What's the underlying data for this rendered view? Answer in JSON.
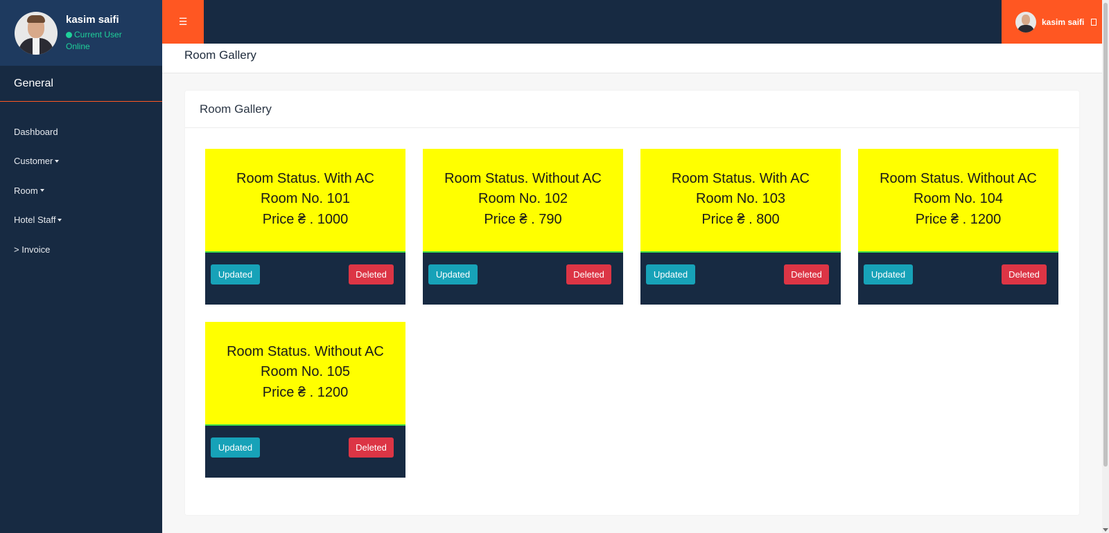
{
  "sidebar": {
    "user_name": "kasim saifi",
    "status_label": "Current User",
    "status_value": "Online",
    "section_title": "General",
    "items": [
      {
        "label": "Dashboard",
        "has_dropdown": false
      },
      {
        "label": "Customer",
        "has_dropdown": true
      },
      {
        "label": "Room",
        "has_dropdown": true
      },
      {
        "label": "Hotel Staff",
        "has_dropdown": true
      },
      {
        "label": "> Invoice",
        "has_dropdown": false
      }
    ]
  },
  "topbar": {
    "menu_icon": "☰",
    "user_name": "kasim saifi"
  },
  "page": {
    "title": "Room Gallery"
  },
  "gallery": {
    "title": "Room Gallery",
    "rooms": [
      {
        "status": "Room Status. With AC",
        "number": "Room No. 101",
        "price": "Price ₴ . 1000",
        "update_label": "Updated",
        "delete_label": "Deleted"
      },
      {
        "status": "Room Status. Without AC",
        "number": "Room No. 102",
        "price": "Price ₴ . 790",
        "update_label": "Updated",
        "delete_label": "Deleted"
      },
      {
        "status": "Room Status. With AC",
        "number": "Room No. 103",
        "price": "Price ₴ . 800",
        "update_label": "Updated",
        "delete_label": "Deleted"
      },
      {
        "status": "Room Status. Without AC",
        "number": "Room No. 104",
        "price": "Price ₴ . 1200",
        "update_label": "Updated",
        "delete_label": "Deleted"
      },
      {
        "status": "Room Status. Without AC",
        "number": "Room No. 105",
        "price": "Price ₴ . 1200",
        "update_label": "Updated",
        "delete_label": "Deleted"
      }
    ]
  },
  "colors": {
    "sidebar_bg": "#172a42",
    "profile_bg": "#1e3a5f",
    "accent": "#ff5722",
    "online": "#1fd19a",
    "room_card": "#ffff00",
    "update_button": "#17a2b8",
    "delete_button": "#dc3545"
  }
}
